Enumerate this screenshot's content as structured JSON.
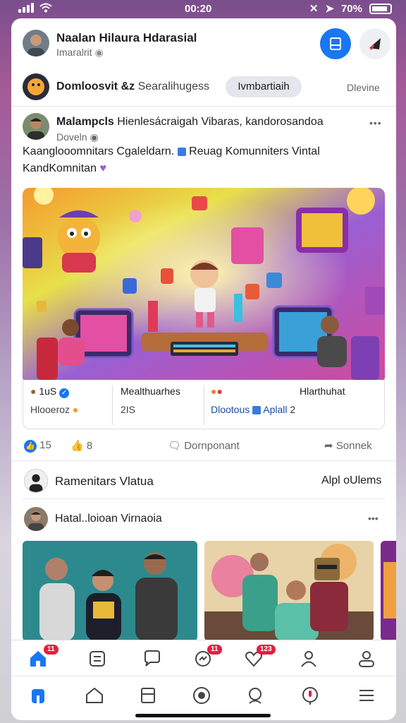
{
  "status_bar": {
    "time": "00:20",
    "battery": "70%"
  },
  "header": {
    "title": "Naalan Hilaura Hdarasial",
    "subtitle": "Imaralrit",
    "icons": [
      "page-icon",
      "megaphone-icon"
    ],
    "accent": "#1877f2"
  },
  "group_bar": {
    "name": "Domloosvit",
    "tag": "&z",
    "search": "Searalihugess",
    "pill": "Ivmbartiaih",
    "more": "Dlevine"
  },
  "post": {
    "author": "Malampcls",
    "headline": "Hienlesácraigah Vibaras, kandorosandoa",
    "meta": "Doveln",
    "text_line1": "Kaanglooomnitars Cgaleldarn.",
    "text_line1b": "Reuag Komunniters Vintal",
    "text_line2": "KandKomnitan",
    "more_label": "•••"
  },
  "stats": {
    "col1_value": "1uS",
    "col1_label": "Hlooeroz",
    "col2_title": "Mealthuarhes",
    "col2_value": "2IS",
    "col3_title": "Hlarthuhat",
    "col3_label1": "Dlootous",
    "col3_label2": "Aplall",
    "col3_value": "2"
  },
  "reactions": {
    "likes": "15",
    "thumbs": "8",
    "comment": "Dornponant",
    "share": "Sonnek"
  },
  "section": {
    "title": "Ramenitars Vlatua",
    "action": "Alpl oUlems"
  },
  "post2": {
    "author": "Hatal..loioan Virnaoia",
    "more_label": "•••"
  },
  "navbar": {
    "top_badges": [
      "11",
      "11",
      "123"
    ],
    "top_icons": [
      "home-icon",
      "news-icon",
      "chat-icon",
      "messenger-icon",
      "heart-icon",
      "friends-icon",
      "profile-icon"
    ],
    "bottom_icons": [
      "home-tab-icon",
      "marketplace-icon",
      "pages-icon",
      "watch-icon",
      "search-icon",
      "notifications-icon",
      "menu-icon"
    ]
  }
}
